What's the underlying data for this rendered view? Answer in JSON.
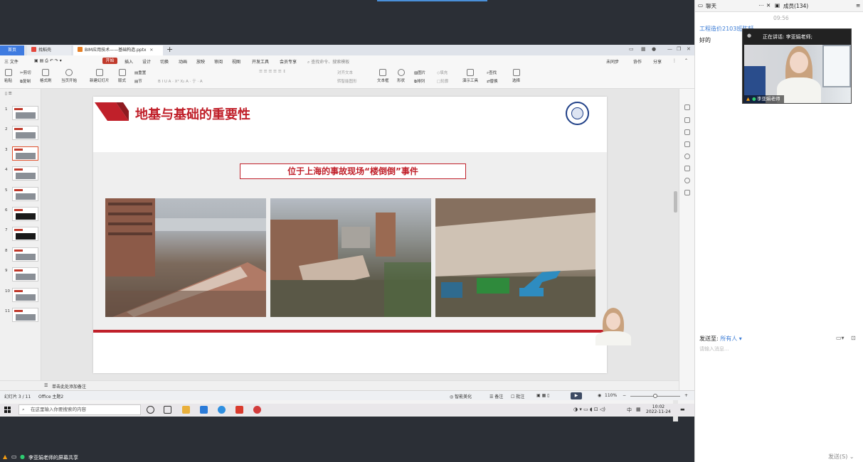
{
  "wps": {
    "tabs": [
      {
        "label": "首页"
      },
      {
        "label": "找稻壳"
      },
      {
        "label": "BIM应用技术——基础构造.pptx"
      }
    ],
    "menus": [
      "三 文件",
      "开始",
      "插入",
      "设计",
      "切换",
      "动画",
      "放映",
      "审阅",
      "视图",
      "开发工具",
      "会员专享"
    ],
    "search_placeholder": "查找命令、搜索模板",
    "right_menu": [
      "未同步",
      "协作",
      "分享"
    ],
    "ribbon": {
      "paste": "粘贴",
      "cut": "剪切",
      "copy": "复制",
      "format_painter": "格式刷",
      "from_current": "当页开始",
      "new_slide": "新建幻灯片",
      "layout": "版式",
      "section": "节",
      "reset": "重置",
      "text_box": "文本框",
      "shape": "形状",
      "picture": "图片",
      "arrange": "排列",
      "fill": "填充",
      "outline": "轮廓",
      "present_tools": "演示工具",
      "find": "查找",
      "replace": "替换",
      "select": "选择",
      "align_text": "对齐文本",
      "to_smartart": "转智能图形"
    },
    "thumbnails": [
      "1",
      "2",
      "3",
      "4",
      "5",
      "6",
      "7",
      "8",
      "9",
      "10",
      "11"
    ],
    "active_thumbnail": 3,
    "slide": {
      "title": "地基与基础的重要性",
      "subtitle": "位于上海的事故现场“楼倒倒”事件"
    },
    "notes_placeholder": "单击此处添加备注",
    "status": {
      "slide_pos": "幻灯片 3 / 11",
      "theme": "Office 主题2",
      "smart_beautify": "智能美化",
      "notes": "备注",
      "comments": "批注",
      "zoom": "110%"
    }
  },
  "taskbar": {
    "search_placeholder": "在这里输入你要搜索的内容",
    "ime": "中",
    "time": "10:02",
    "date": "2022-11-24"
  },
  "share": {
    "label": "李亚娟老师的屏幕共享"
  },
  "chat": {
    "tab_chat": "聊天",
    "tab_members": "成员(134)",
    "time": "09:56",
    "sender": "工程造价2103班陈轩",
    "message": "好的",
    "speaking_label": "正在讲话: 李亚娟老师;",
    "speaker_name": "李亚娟老师",
    "send_to_label": "发送至:",
    "send_to_value": "所有人",
    "input_placeholder": "请输入消息...",
    "send_button": "发送(S)"
  },
  "colors": {
    "accent_red": "#c0202a",
    "wps_blue": "#3f7be0",
    "link_blue": "#3a7bd5"
  }
}
